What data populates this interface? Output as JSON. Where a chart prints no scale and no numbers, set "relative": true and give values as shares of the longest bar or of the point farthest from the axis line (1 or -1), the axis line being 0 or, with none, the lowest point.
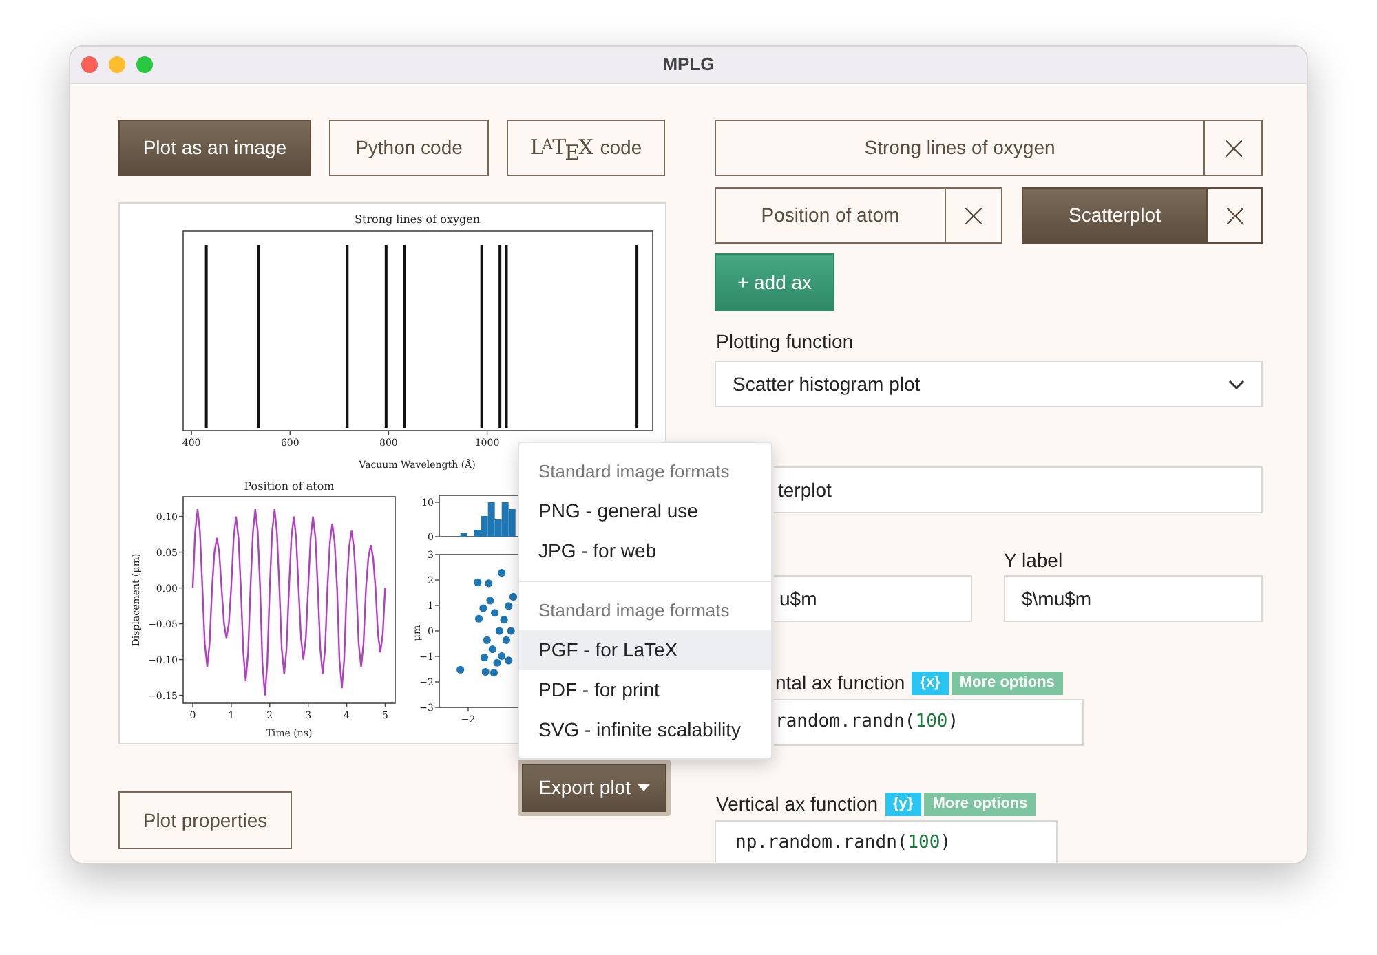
{
  "window": {
    "title": "MPLG"
  },
  "view_buttons": [
    {
      "kind": "text",
      "label": "Plot as an image",
      "selected": true
    },
    {
      "kind": "text",
      "label": "Python code",
      "selected": false
    },
    {
      "kind": "latex",
      "logo": "LATEX",
      "label": "code",
      "selected": false
    }
  ],
  "figure": {
    "panels": [
      {
        "kind": "spectrum",
        "chart_data": {
          "type": "bar",
          "title": "Strong lines of oxygen",
          "xlabel": "Vacuum Wavelength (Å)",
          "x": [
            430,
            536,
            716,
            795,
            832,
            989,
            1026,
            1039,
            1304
          ],
          "values": [
            1,
            1,
            1,
            1,
            1,
            1,
            1,
            1,
            1
          ],
          "relative": true,
          "xlim": [
            383,
            1336
          ],
          "xticks": [
            400,
            600,
            800,
            1000
          ]
        }
      },
      {
        "kind": "timeseries",
        "chart_data": {
          "type": "line",
          "title": "Position of atom",
          "xlabel": "Time (ns)",
          "ylabel": "Displacement (μm)",
          "xlim": [
            -0.25,
            5.26
          ],
          "ylim": [
            -0.161,
            0.1275
          ],
          "xticks": [
            0,
            1,
            2,
            3,
            4,
            5
          ],
          "yticks": [
            {
              "value": 0.1,
              "label": "0.10"
            },
            {
              "value": 0.05,
              "label": "0.05"
            },
            {
              "value": 0,
              "label": "0.00"
            },
            {
              "value": -0.05,
              "label": "−0.05"
            },
            {
              "value": -0.1,
              "label": "−0.10"
            },
            {
              "value": -0.15,
              "label": "−0.15"
            }
          ],
          "x": [
            0,
            0.0625,
            0.125,
            0.1875,
            0.25,
            0.3125,
            0.375,
            0.4375,
            0.5,
            0.5625,
            0.625,
            0.6875,
            0.75,
            0.8125,
            0.875,
            0.9375,
            1,
            1.0625,
            1.125,
            1.1875,
            1.25,
            1.3125,
            1.375,
            1.4375,
            1.5,
            1.5625,
            1.625,
            1.6875,
            1.75,
            1.8125,
            1.875,
            1.9375,
            2,
            2.0625,
            2.125,
            2.1875,
            2.25,
            2.3125,
            2.375,
            2.4375,
            2.5,
            2.5625,
            2.625,
            2.6875,
            2.75,
            2.8125,
            2.875,
            2.9375,
            3,
            3.0625,
            3.125,
            3.1875,
            3.25,
            3.3125,
            3.375,
            3.4375,
            3.5,
            3.5625,
            3.625,
            3.6875,
            3.75,
            3.8125,
            3.875,
            3.9375,
            4,
            4.0625,
            4.125,
            4.1875,
            4.25,
            4.3125,
            4.375,
            4.4375,
            4.5,
            4.5625,
            4.625,
            4.6875,
            4.75,
            4.8125,
            4.875,
            4.9375,
            5
          ],
          "series": [
            {
              "color": "#b03fc2",
              "values": [
                0,
                0.078,
                0.11,
                0.078,
                0,
                -0.078,
                -0.11,
                -0.078,
                0,
                0.05,
                0.07,
                0.05,
                0,
                -0.05,
                -0.07,
                -0.05,
                0,
                0.07,
                0.1,
                0.07,
                0,
                -0.09,
                -0.13,
                -0.09,
                0,
                0.078,
                0.11,
                0.078,
                0,
                -0.106,
                -0.15,
                -0.106,
                0,
                0.078,
                0.11,
                0.078,
                0,
                -0.085,
                -0.12,
                -0.085,
                0,
                0.07,
                0.1,
                0.07,
                0,
                -0.07,
                -0.1,
                -0.07,
                0,
                0.07,
                0.1,
                0.07,
                0,
                -0.085,
                -0.12,
                -0.085,
                0,
                0.064,
                0.09,
                0.064,
                0,
                -0.099,
                -0.14,
                -0.099,
                0,
                0.057,
                0.08,
                0.057,
                0,
                -0.078,
                -0.11,
                -0.078,
                0,
                0.042,
                0.06,
                0.042,
                0,
                -0.064,
                -0.09,
                -0.064,
                0
              ]
            }
          ]
        }
      },
      {
        "kind": "histogram",
        "y_tick_labels": [
          "10",
          "0"
        ]
      },
      {
        "kind": "scatter",
        "ylabel": "μm",
        "y_tick_labels": [
          "3",
          "2",
          "1",
          "0",
          "−1",
          "−2",
          "−3"
        ],
        "x_tick_labels": [
          "−2"
        ]
      }
    ]
  },
  "export_button": {
    "label": "Export plot"
  },
  "plot_properties_button": {
    "label": "Plot properties"
  },
  "export_menu": {
    "groups": [
      {
        "header": "Standard image formats",
        "items": [
          {
            "label": "PNG - general use",
            "selected": false
          },
          {
            "label": "JPG - for web",
            "selected": false
          }
        ]
      },
      {
        "header": "Standard image formats",
        "items": [
          {
            "label": "PGF - for LaTeX",
            "selected": true
          },
          {
            "label": "PDF - for print",
            "selected": false
          },
          {
            "label": "SVG - infinite scalability",
            "selected": false
          }
        ]
      }
    ]
  },
  "ax_tabs": [
    [
      {
        "label": "Strong lines of oxygen",
        "selected": false
      }
    ],
    [
      {
        "label": "Position of atom",
        "selected": false
      },
      {
        "label": "Scatterplot",
        "selected": true
      }
    ]
  ],
  "add_ax_button": {
    "label": "+ add ax"
  },
  "plotting_function": {
    "label": "Plotting function",
    "value": "Scatter histogram plot"
  },
  "title_field": {
    "value": "terplot"
  },
  "x_label_field": {
    "value": "u$m"
  },
  "y_label_field": {
    "label": "Y label",
    "value": "$\\mu$m"
  },
  "functions": [
    {
      "label": "ntal ax function",
      "variable": "{x}",
      "more": "More options",
      "code": [
        {
          "kind": "plain",
          "text": "random.randn("
        },
        {
          "kind": "number",
          "text": "100"
        },
        {
          "kind": "plain",
          "text": ")"
        }
      ]
    },
    {
      "label": "Vertical ax function",
      "variable": "{y}",
      "more": "More options",
      "code": [
        {
          "kind": "plain",
          "text": "np.random.randn("
        },
        {
          "kind": "number",
          "text": "100"
        },
        {
          "kind": "plain",
          "text": ")"
        }
      ]
    }
  ]
}
